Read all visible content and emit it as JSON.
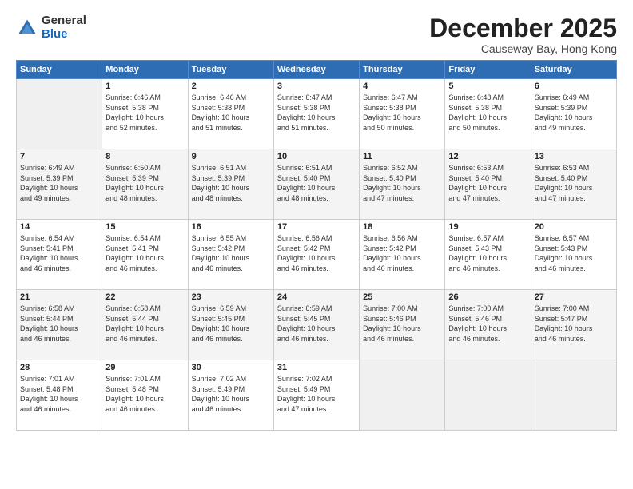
{
  "logo": {
    "general": "General",
    "blue": "Blue"
  },
  "title": "December 2025",
  "location": "Causeway Bay, Hong Kong",
  "days_of_week": [
    "Sunday",
    "Monday",
    "Tuesday",
    "Wednesday",
    "Thursday",
    "Friday",
    "Saturday"
  ],
  "weeks": [
    [
      {
        "num": "",
        "info": ""
      },
      {
        "num": "1",
        "info": "Sunrise: 6:46 AM\nSunset: 5:38 PM\nDaylight: 10 hours\nand 52 minutes."
      },
      {
        "num": "2",
        "info": "Sunrise: 6:46 AM\nSunset: 5:38 PM\nDaylight: 10 hours\nand 51 minutes."
      },
      {
        "num": "3",
        "info": "Sunrise: 6:47 AM\nSunset: 5:38 PM\nDaylight: 10 hours\nand 51 minutes."
      },
      {
        "num": "4",
        "info": "Sunrise: 6:47 AM\nSunset: 5:38 PM\nDaylight: 10 hours\nand 50 minutes."
      },
      {
        "num": "5",
        "info": "Sunrise: 6:48 AM\nSunset: 5:38 PM\nDaylight: 10 hours\nand 50 minutes."
      },
      {
        "num": "6",
        "info": "Sunrise: 6:49 AM\nSunset: 5:39 PM\nDaylight: 10 hours\nand 49 minutes."
      }
    ],
    [
      {
        "num": "7",
        "info": "Sunrise: 6:49 AM\nSunset: 5:39 PM\nDaylight: 10 hours\nand 49 minutes."
      },
      {
        "num": "8",
        "info": "Sunrise: 6:50 AM\nSunset: 5:39 PM\nDaylight: 10 hours\nand 48 minutes."
      },
      {
        "num": "9",
        "info": "Sunrise: 6:51 AM\nSunset: 5:39 PM\nDaylight: 10 hours\nand 48 minutes."
      },
      {
        "num": "10",
        "info": "Sunrise: 6:51 AM\nSunset: 5:40 PM\nDaylight: 10 hours\nand 48 minutes."
      },
      {
        "num": "11",
        "info": "Sunrise: 6:52 AM\nSunset: 5:40 PM\nDaylight: 10 hours\nand 47 minutes."
      },
      {
        "num": "12",
        "info": "Sunrise: 6:53 AM\nSunset: 5:40 PM\nDaylight: 10 hours\nand 47 minutes."
      },
      {
        "num": "13",
        "info": "Sunrise: 6:53 AM\nSunset: 5:40 PM\nDaylight: 10 hours\nand 47 minutes."
      }
    ],
    [
      {
        "num": "14",
        "info": "Sunrise: 6:54 AM\nSunset: 5:41 PM\nDaylight: 10 hours\nand 46 minutes."
      },
      {
        "num": "15",
        "info": "Sunrise: 6:54 AM\nSunset: 5:41 PM\nDaylight: 10 hours\nand 46 minutes."
      },
      {
        "num": "16",
        "info": "Sunrise: 6:55 AM\nSunset: 5:42 PM\nDaylight: 10 hours\nand 46 minutes."
      },
      {
        "num": "17",
        "info": "Sunrise: 6:56 AM\nSunset: 5:42 PM\nDaylight: 10 hours\nand 46 minutes."
      },
      {
        "num": "18",
        "info": "Sunrise: 6:56 AM\nSunset: 5:42 PM\nDaylight: 10 hours\nand 46 minutes."
      },
      {
        "num": "19",
        "info": "Sunrise: 6:57 AM\nSunset: 5:43 PM\nDaylight: 10 hours\nand 46 minutes."
      },
      {
        "num": "20",
        "info": "Sunrise: 6:57 AM\nSunset: 5:43 PM\nDaylight: 10 hours\nand 46 minutes."
      }
    ],
    [
      {
        "num": "21",
        "info": "Sunrise: 6:58 AM\nSunset: 5:44 PM\nDaylight: 10 hours\nand 46 minutes."
      },
      {
        "num": "22",
        "info": "Sunrise: 6:58 AM\nSunset: 5:44 PM\nDaylight: 10 hours\nand 46 minutes."
      },
      {
        "num": "23",
        "info": "Sunrise: 6:59 AM\nSunset: 5:45 PM\nDaylight: 10 hours\nand 46 minutes."
      },
      {
        "num": "24",
        "info": "Sunrise: 6:59 AM\nSunset: 5:45 PM\nDaylight: 10 hours\nand 46 minutes."
      },
      {
        "num": "25",
        "info": "Sunrise: 7:00 AM\nSunset: 5:46 PM\nDaylight: 10 hours\nand 46 minutes."
      },
      {
        "num": "26",
        "info": "Sunrise: 7:00 AM\nSunset: 5:46 PM\nDaylight: 10 hours\nand 46 minutes."
      },
      {
        "num": "27",
        "info": "Sunrise: 7:00 AM\nSunset: 5:47 PM\nDaylight: 10 hours\nand 46 minutes."
      }
    ],
    [
      {
        "num": "28",
        "info": "Sunrise: 7:01 AM\nSunset: 5:48 PM\nDaylight: 10 hours\nand 46 minutes."
      },
      {
        "num": "29",
        "info": "Sunrise: 7:01 AM\nSunset: 5:48 PM\nDaylight: 10 hours\nand 46 minutes."
      },
      {
        "num": "30",
        "info": "Sunrise: 7:02 AM\nSunset: 5:49 PM\nDaylight: 10 hours\nand 46 minutes."
      },
      {
        "num": "31",
        "info": "Sunrise: 7:02 AM\nSunset: 5:49 PM\nDaylight: 10 hours\nand 47 minutes."
      },
      {
        "num": "",
        "info": ""
      },
      {
        "num": "",
        "info": ""
      },
      {
        "num": "",
        "info": ""
      }
    ]
  ]
}
